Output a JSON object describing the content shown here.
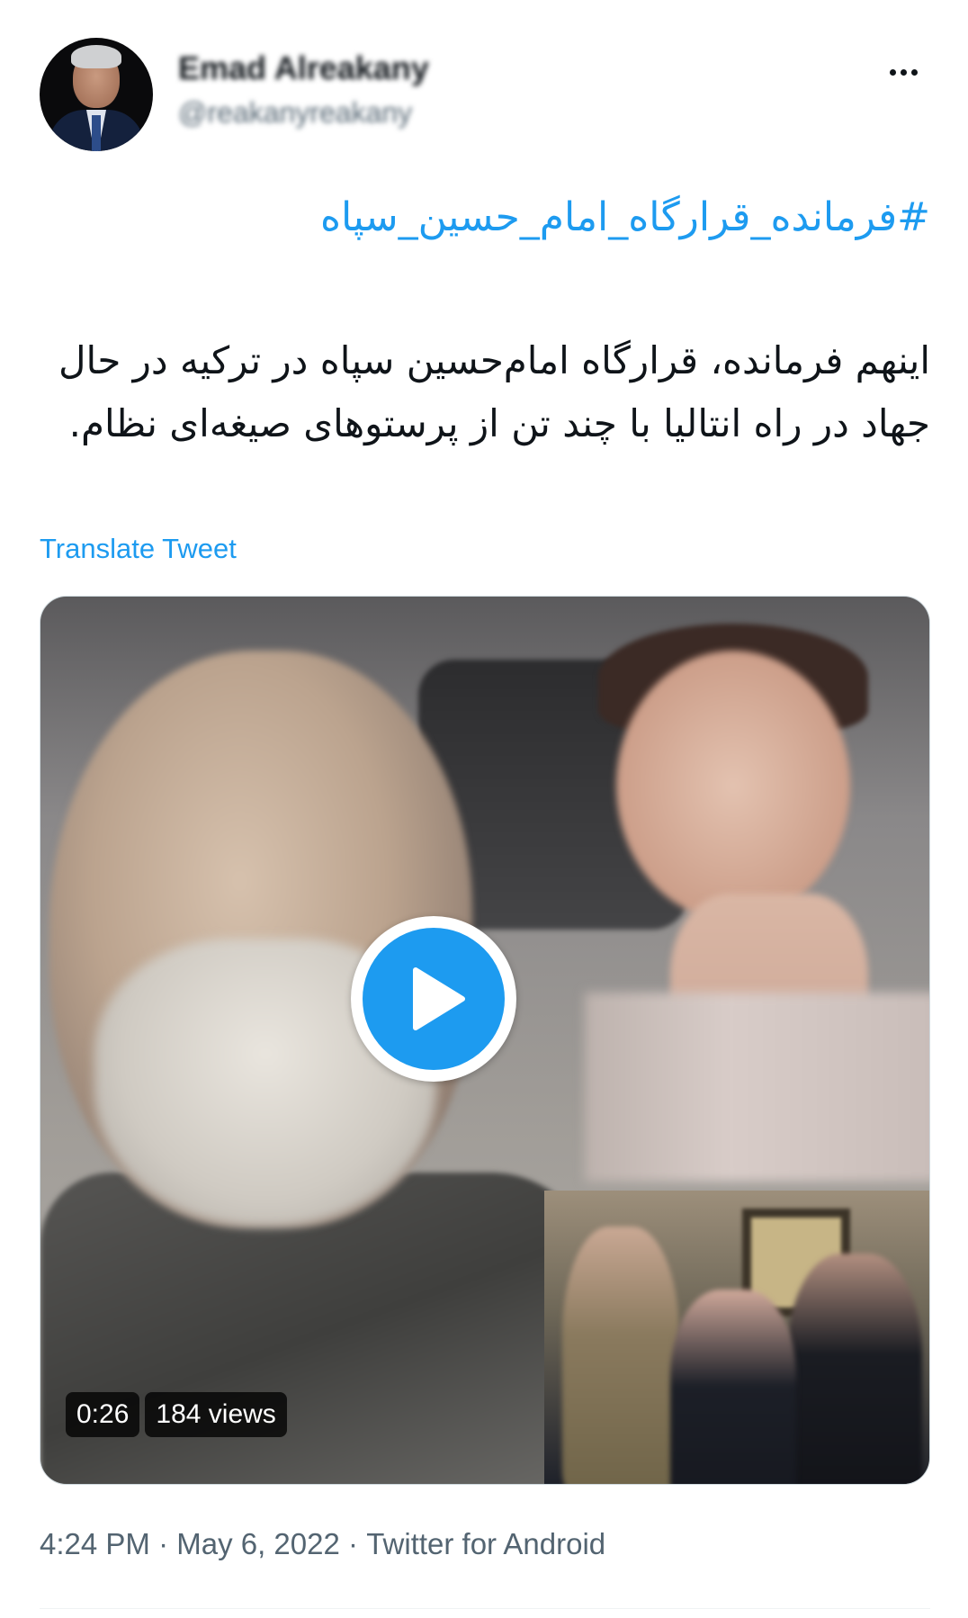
{
  "author": {
    "display_name": "Emad Alreakany",
    "handle": "@reakanyreakany",
    "avatar_icon": "profile-photo"
  },
  "more_icon": "more-horizontal-icon",
  "hashtag": "#فرمانده_قرارگاه_امام_حسین_سپاه",
  "tweet_text": "اینهم فرمانده، قرارگاه امام‌حسین سپاه در ترکیه در حال جهاد در راه انتالیا با چند تن از پرستوهای صیغه‌ای نظام.",
  "translate_label": "Translate Tweet",
  "media": {
    "type": "video",
    "play_icon": "play-icon",
    "duration": "0:26",
    "views": "184 views"
  },
  "meta": {
    "time": "4:24 PM",
    "separator": " · ",
    "date": "May 6, 2022",
    "source": "Twitter for Android"
  },
  "colors": {
    "accent": "#1d9bf0",
    "text": "#0f1419",
    "secondary_text": "#536471"
  }
}
